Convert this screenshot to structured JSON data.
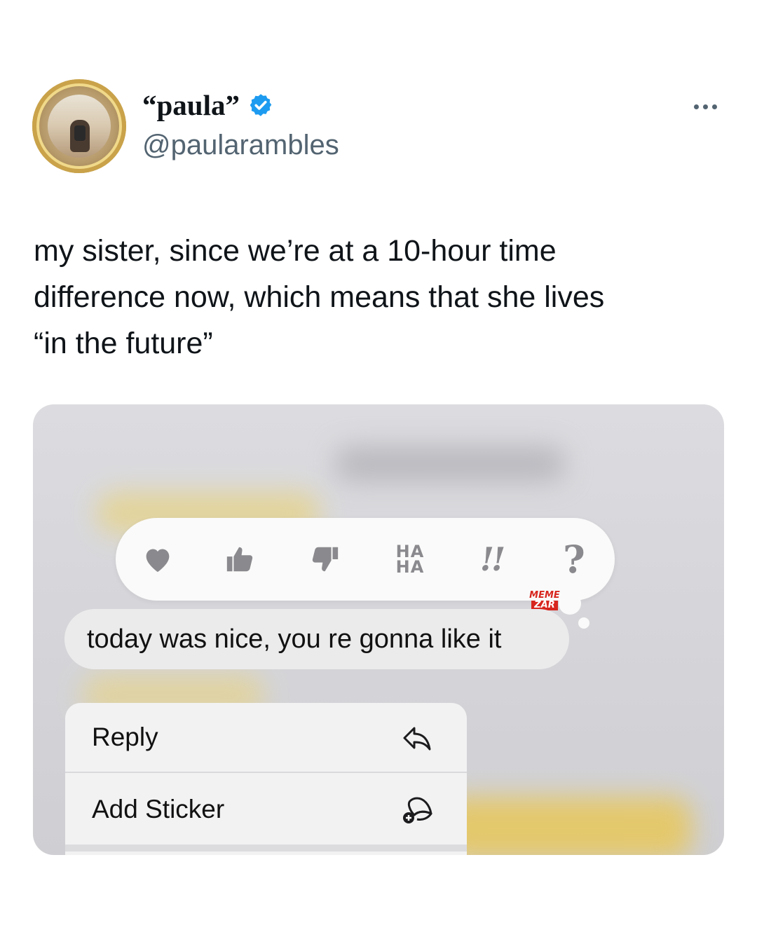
{
  "tweet": {
    "display_name": "“paula”",
    "handle": "@paularambles",
    "verified_color": "#1d9bf0",
    "text_lines": [
      "my sister, since we’re at a 10-hour time",
      "difference now, which means that she lives",
      "“in the future”"
    ]
  },
  "screenshot": {
    "tapbacks": [
      {
        "icon": "heart-icon"
      },
      {
        "icon": "thumbs-up-icon"
      },
      {
        "icon": "thumbs-down-icon"
      },
      {
        "label": "HA\nHA"
      },
      {
        "label": "!!"
      },
      {
        "label": "?"
      }
    ],
    "haha_top": "HA",
    "haha_bottom": "HA",
    "exclaim": "!!",
    "question": "?",
    "watermark_top": "MEME",
    "watermark_bottom": "ZAR",
    "message": "today was nice, you re gonna like it",
    "menu": [
      {
        "label": "Reply",
        "icon": "reply-icon"
      },
      {
        "label": "Add Sticker",
        "icon": "add-sticker-icon"
      }
    ]
  }
}
